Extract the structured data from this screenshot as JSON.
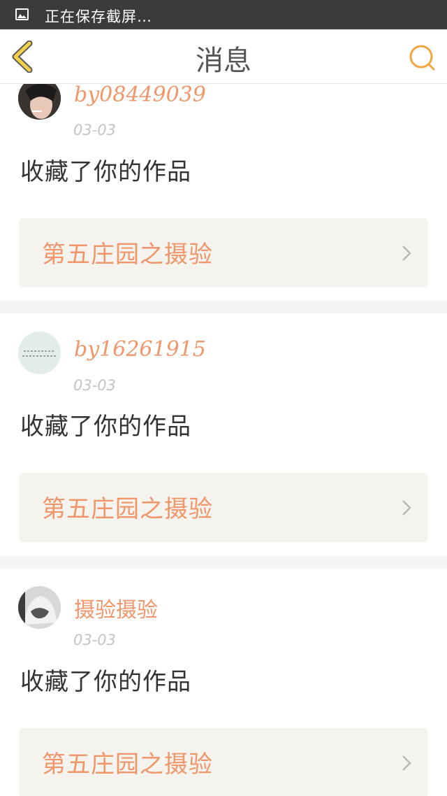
{
  "status_bar": {
    "text": "正在保存截屏…",
    "icon": "image-icon"
  },
  "header": {
    "title": "消息",
    "back_icon": "chevron-left-icon",
    "search_icon": "search-icon",
    "accent_color": "#f0a640"
  },
  "colors": {
    "username": "#f0966a",
    "work_title": "#f0966a",
    "date": "#c4c4c4",
    "work_box_bg": "#f4f3ee",
    "divider": "#f4f4f4"
  },
  "notifications": [
    {
      "username": "by08449039",
      "date": "03-03",
      "action": "收藏了你的作品",
      "work_title": "第五庄园之摄验"
    },
    {
      "username": "by16261915",
      "date": "03-03",
      "action": "收藏了你的作品",
      "work_title": "第五庄园之摄验",
      "avatar_caption": ""
    },
    {
      "username": "摄验摄验",
      "date": "03-03",
      "action": "收藏了你的作品",
      "work_title": "第五庄园之摄验"
    }
  ]
}
